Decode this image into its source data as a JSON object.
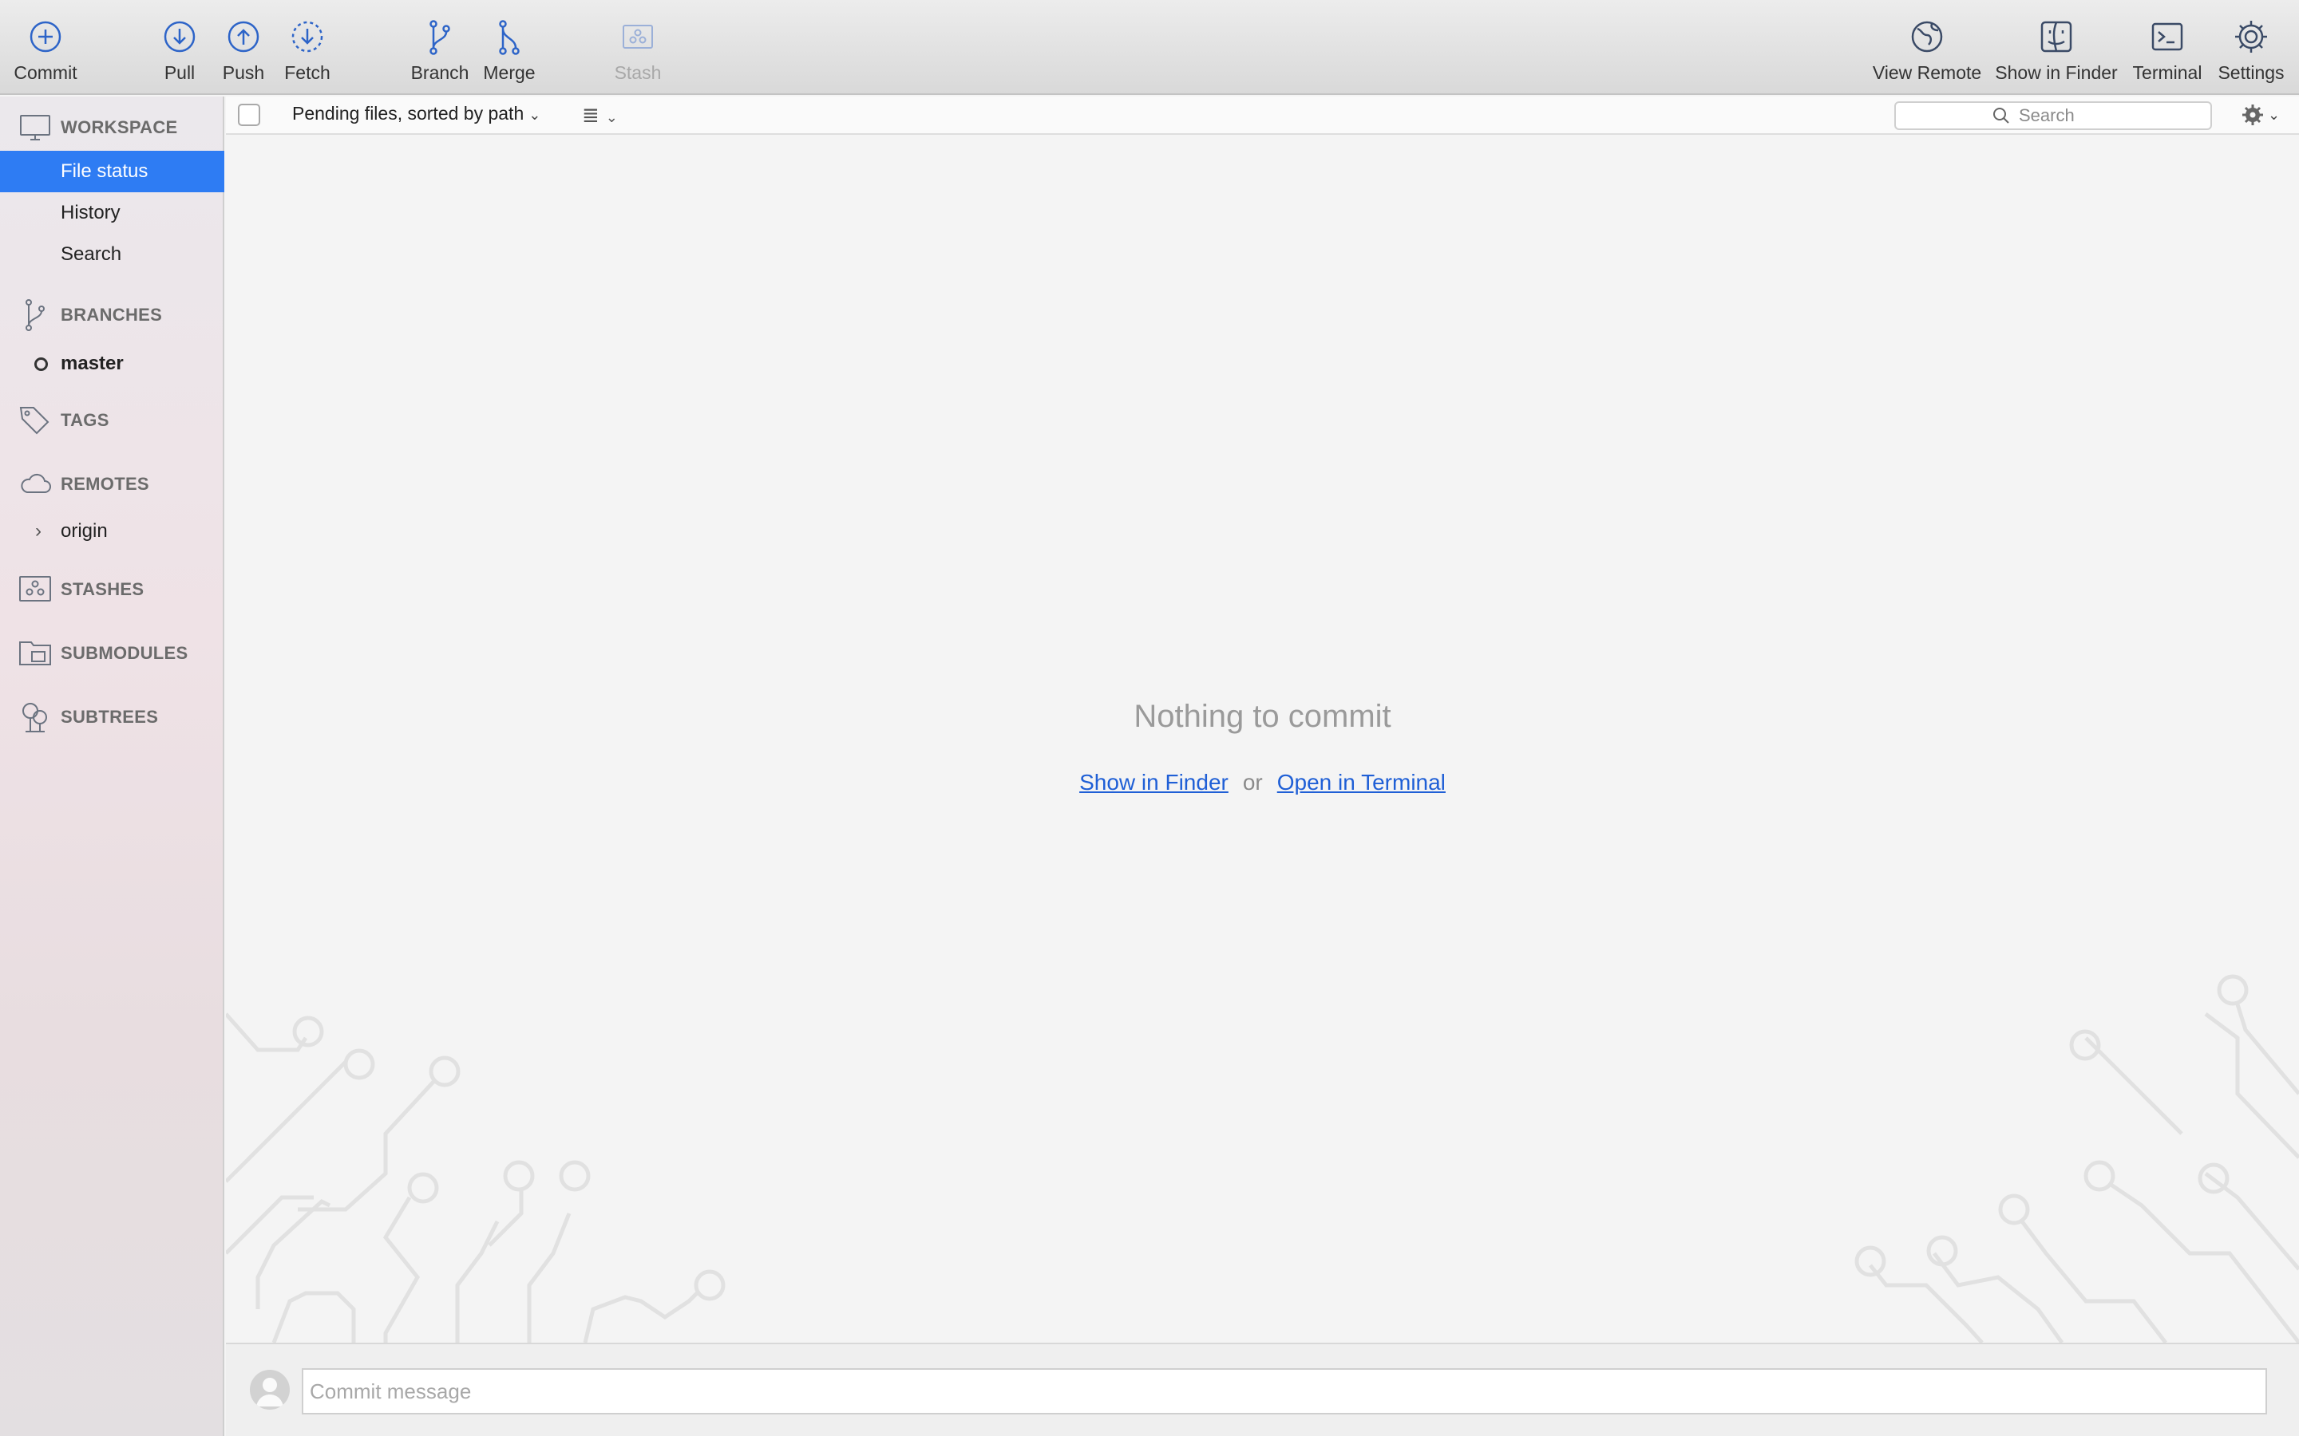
{
  "toolbar": {
    "commit": "Commit",
    "pull": "Pull",
    "push": "Push",
    "fetch": "Fetch",
    "branch": "Branch",
    "merge": "Merge",
    "stash": "Stash",
    "view_remote": "View Remote",
    "show_in_finder": "Show in Finder",
    "terminal": "Terminal",
    "settings": "Settings"
  },
  "sidebar": {
    "workspace": "WORKSPACE",
    "workspace_items": [
      "File status",
      "History",
      "Search"
    ],
    "branches": "BRANCHES",
    "branch_items": [
      "master"
    ],
    "tags": "TAGS",
    "remotes": "REMOTES",
    "remote_items": [
      "origin"
    ],
    "stashes": "STASHES",
    "submodules": "SUBMODULES",
    "subtrees": "SUBTREES"
  },
  "filebar": {
    "sort_label": "Pending files, sorted by path",
    "search_placeholder": "Search"
  },
  "main": {
    "empty_title": "Nothing to commit",
    "link_finder": "Show in Finder",
    "or": "or",
    "link_terminal": "Open in Terminal"
  },
  "commit": {
    "placeholder": "Commit message"
  },
  "colors": {
    "accent": "#2e7cf3",
    "icon_blue": "#2d64c8",
    "link": "#1f5fd6"
  }
}
